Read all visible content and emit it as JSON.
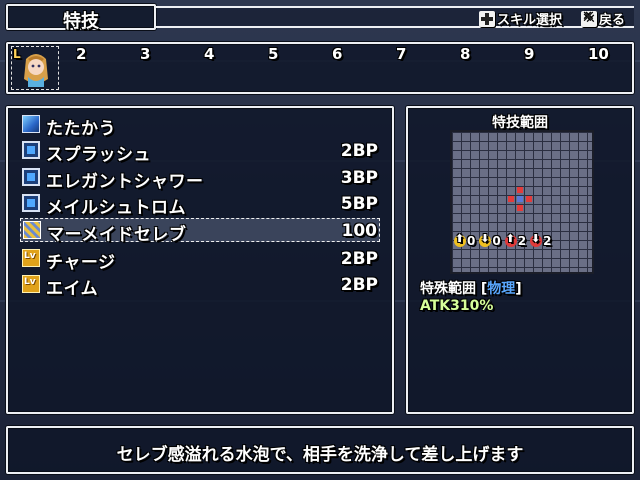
{
  "header": {
    "title": "特技",
    "hint_skill_select": "スキル選択",
    "hint_back": "戻る"
  },
  "party": {
    "current_slot_badge": "L",
    "slot_numbers": [
      "2",
      "3",
      "4",
      "5",
      "6",
      "7",
      "8",
      "9",
      "10"
    ]
  },
  "skills": [
    {
      "name": "たたかう",
      "cost": "",
      "icon": "attack-icon"
    },
    {
      "name": "スプラッシュ",
      "cost": "2BP",
      "icon": "water-skill-icon"
    },
    {
      "name": "エレガントシャワー",
      "cost": "3BP",
      "icon": "water-skill-icon"
    },
    {
      "name": "メイルシュトロム",
      "cost": "5BP",
      "icon": "water-skill-icon"
    },
    {
      "name": "マーメイドセレブ",
      "cost": "100",
      "icon": "special-skill-icon"
    },
    {
      "name": "チャージ",
      "cost": "2BP",
      "icon": "buff-skill-icon"
    },
    {
      "name": "エイム",
      "cost": "2BP",
      "icon": "buff-skill-icon"
    }
  ],
  "selected_skill_index": 4,
  "range": {
    "title": "特技範囲",
    "stat_values": [
      "0",
      "0",
      "2",
      "2"
    ],
    "type_prefix": "特殊範囲 [",
    "type_value": "物理",
    "type_suffix": "]",
    "atk": "ATK310%"
  },
  "description": "セレブ感溢れる水泡で、相手を洗浄して差し上げます",
  "colors": {
    "panel_border": "#eef0f4",
    "panel_bg": "#0f1628",
    "hit_red": "#e23b3b",
    "range_blue": "#5aa8ff",
    "atk_green": "#d6ff9a"
  }
}
